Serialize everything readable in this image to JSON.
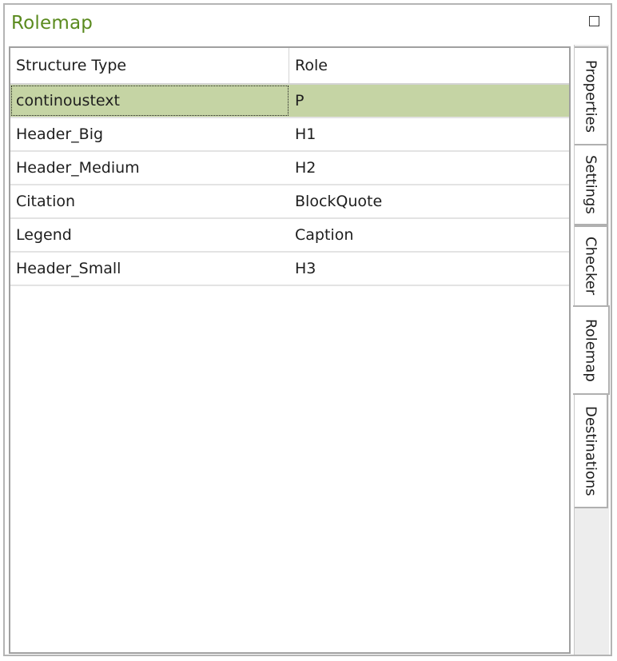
{
  "panel": {
    "title": "Rolemap"
  },
  "table": {
    "columns": [
      "Structure Type",
      "Role"
    ],
    "rows": [
      {
        "structure": "continoustext",
        "role": "P"
      },
      {
        "structure": "Header_Big",
        "role": "H1"
      },
      {
        "structure": "Header_Medium",
        "role": "H2"
      },
      {
        "structure": "Citation",
        "role": "BlockQuote"
      },
      {
        "structure": "Legend",
        "role": "Caption"
      },
      {
        "structure": "Header_Small",
        "role": "H3"
      }
    ],
    "selected_row": 0,
    "selected_color": "#c5d4a4"
  },
  "tabs": [
    {
      "label": "Properties"
    },
    {
      "label": "Settings"
    },
    {
      "label": "Checker"
    },
    {
      "label": "Rolemap",
      "active": true
    },
    {
      "label": "Destinations"
    }
  ],
  "colors": {
    "title": "#5a8a1e",
    "tab_strip": "#ededed"
  },
  "icons": {
    "maximize": "maximize-icon"
  }
}
